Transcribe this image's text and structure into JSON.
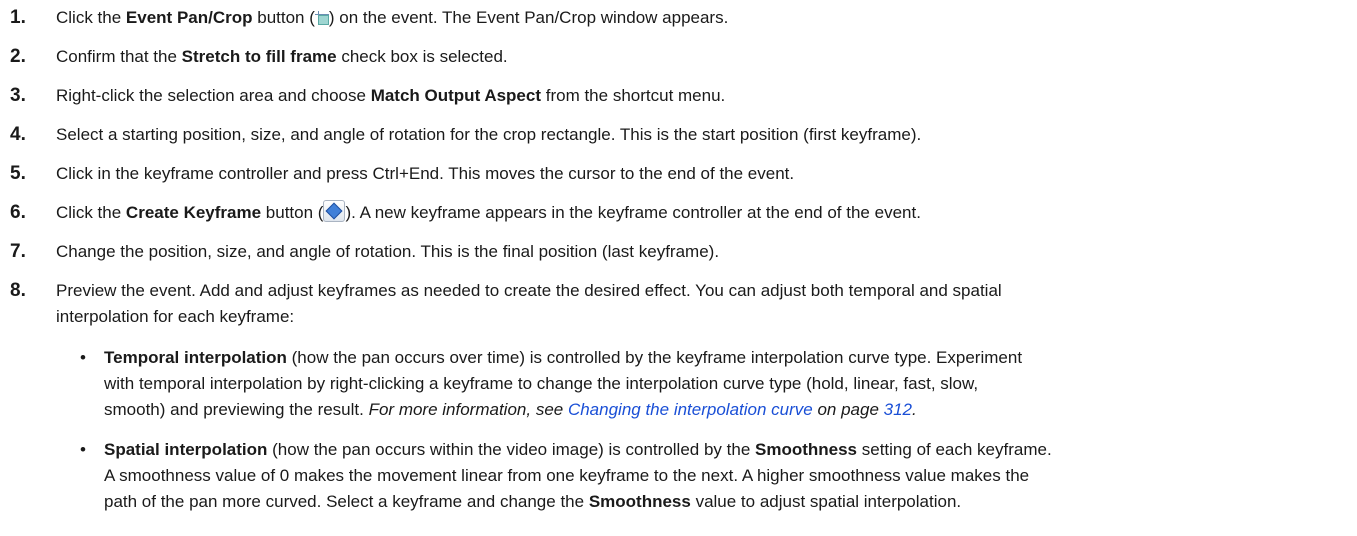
{
  "steps": [
    {
      "num": "1.",
      "pre": "Click the ",
      "bold": "Event Pan/Crop",
      "mid": " button (",
      "post": ") on the event. The Event Pan/Crop window appears."
    },
    {
      "num": "2.",
      "pre": "Confirm that the ",
      "bold": "Stretch to fill frame",
      "post": " check box is selected."
    },
    {
      "num": "3.",
      "pre": "Right-click the selection area and choose ",
      "bold": "Match Output Aspect",
      "post": " from the shortcut menu."
    },
    {
      "num": "4.",
      "text": "Select a starting position, size, and angle of rotation for the crop rectangle. This is the start position (first keyframe)."
    },
    {
      "num": "5.",
      "text": "Click in the keyframe controller and press Ctrl+End. This moves the cursor to the end of the event."
    },
    {
      "num": "6.",
      "pre": "Click the ",
      "bold": "Create Keyframe",
      "mid": " button (",
      "post": "). A new keyframe appears in the keyframe controller at the end of the event."
    },
    {
      "num": "7.",
      "text": "Change the position, size, and angle of rotation. This is the final position (last keyframe)."
    },
    {
      "num": "8.",
      "line1": "Preview the event. Add and adjust keyframes as needed to create the desired effect. You can adjust both temporal and spatial",
      "line2": "interpolation for each keyframe:"
    }
  ],
  "bullets": [
    {
      "bullet": "•",
      "bold": "Temporal interpolation",
      "line1": " (how the pan occurs over time) is controlled by the keyframe interpolation curve type. Experiment",
      "line2": "with temporal interpolation by right-clicking a keyframe to change the interpolation curve type (hold, linear, fast, slow,",
      "line3": "smooth) and previewing the result. ",
      "italic_pre": "For more information, see ",
      "link": "Changing the interpolation curve",
      "italic_mid": " on page ",
      "page": "312",
      "italic_end": "."
    },
    {
      "bullet": "•",
      "bold": "Spatial interpolation",
      "line1": " (how the pan occurs within the video image) is controlled by the ",
      "bold2": "Smoothness",
      "line1b": " setting of each keyframe.",
      "line2": "A smoothness value of 0 makes the movement linear from one keyframe to the next. A higher smoothness value makes the",
      "line3": "path of the pan more curved. Select a keyframe and change the ",
      "bold3": "Smoothness",
      "line3b": " value to adjust spatial interpolation."
    }
  ],
  "icons": {
    "crop": "crop-icon",
    "keyframe": "create-keyframe-icon"
  }
}
